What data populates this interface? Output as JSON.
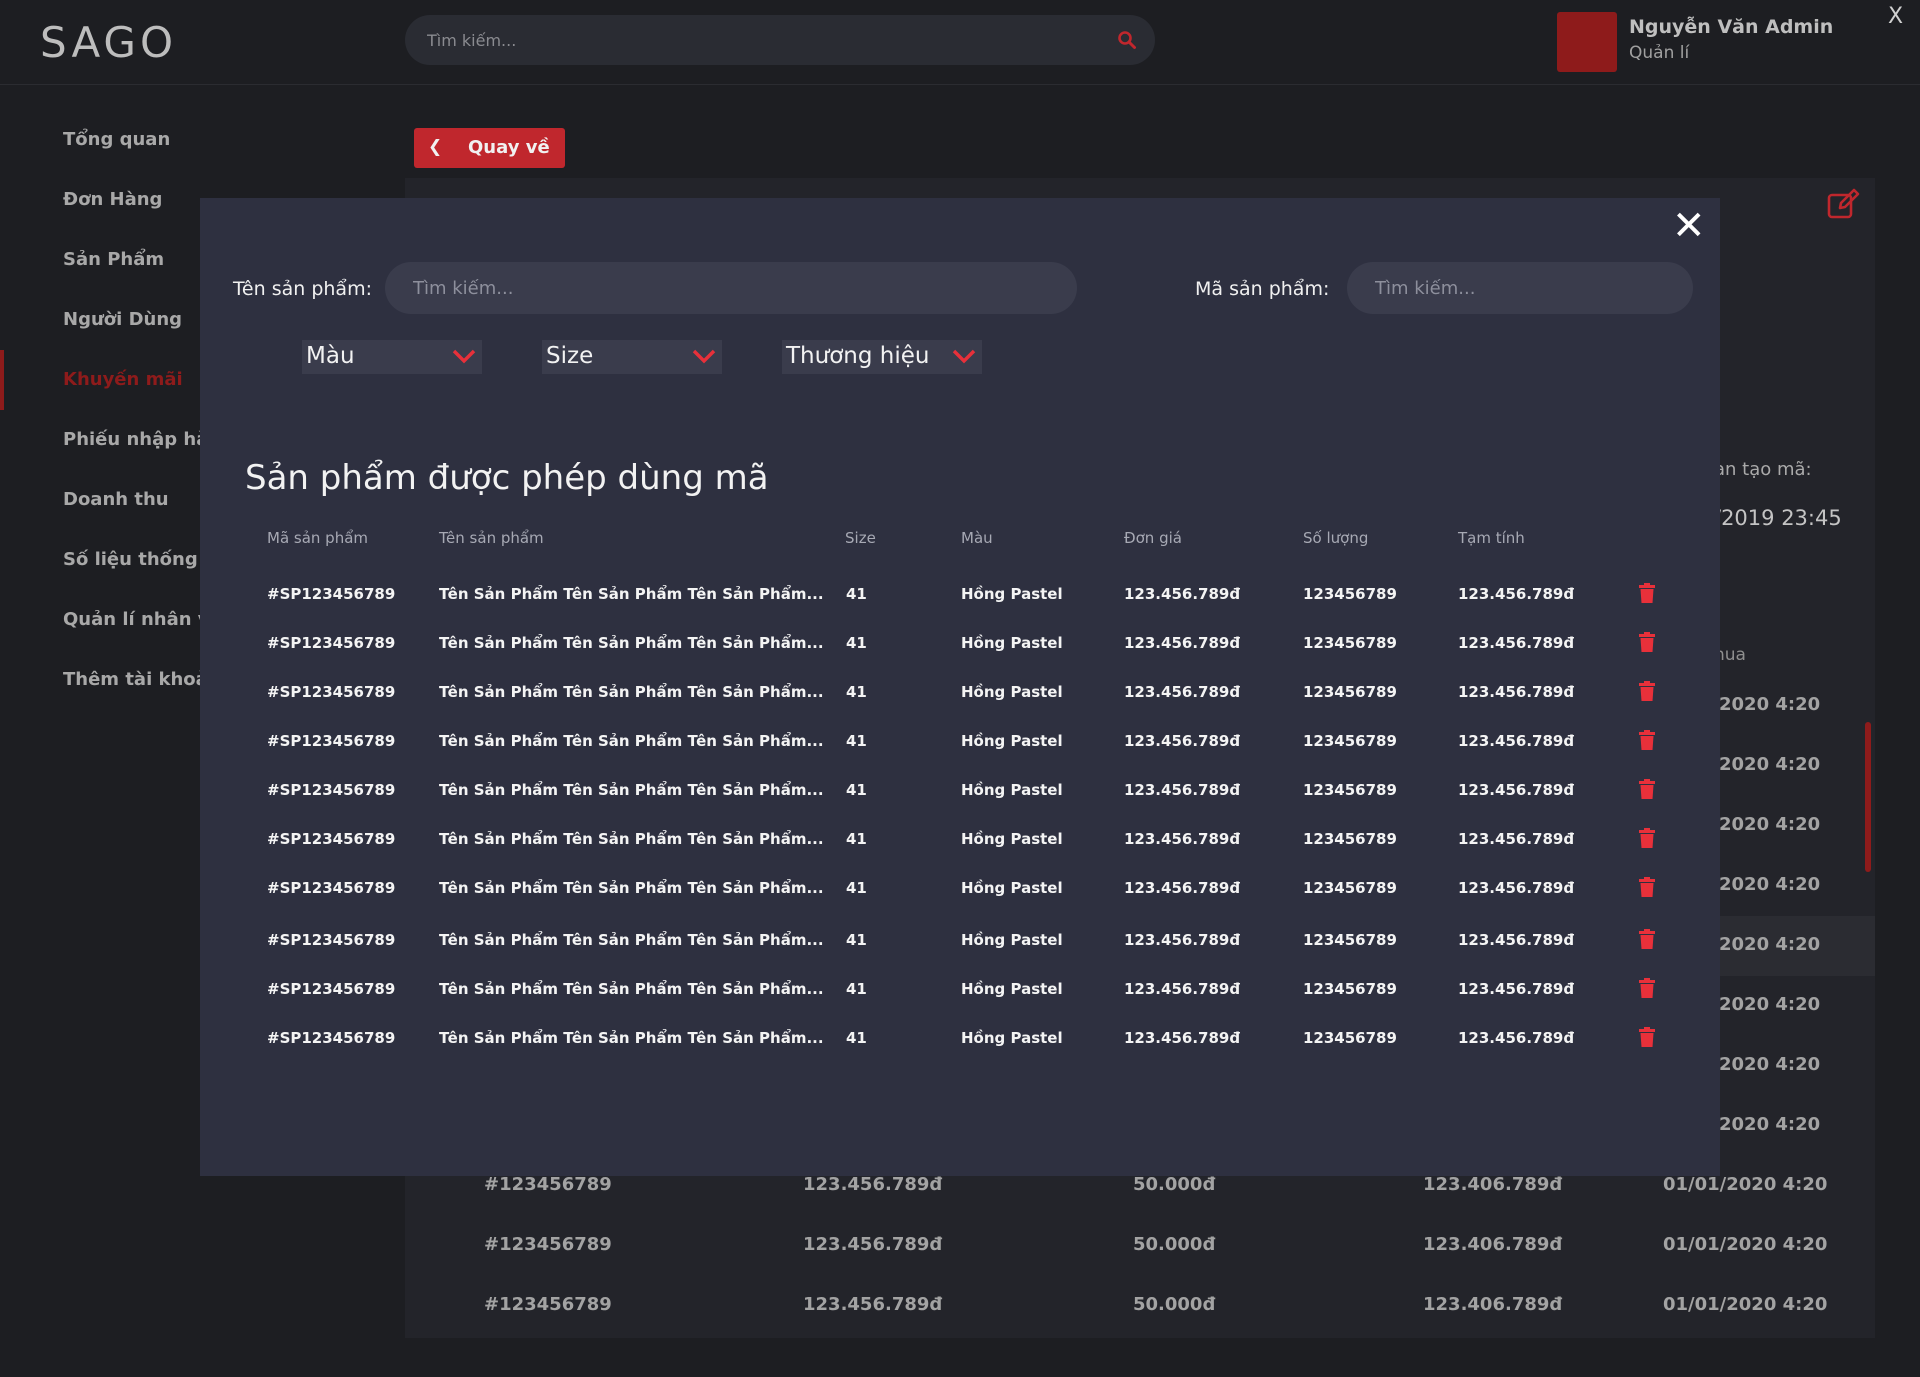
{
  "app": {
    "logo": "SAGO",
    "search_placeholder": "Tìm kiếm...",
    "user_name": "Nguyễn Văn Admin",
    "user_role": "Quản lí",
    "window_close": "X"
  },
  "sidebar": {
    "items": [
      {
        "label": "Tổng quan"
      },
      {
        "label": "Đơn Hàng"
      },
      {
        "label": "Sản Phẩm"
      },
      {
        "label": "Người Dùng"
      },
      {
        "label": "Khuyến mãi"
      },
      {
        "label": "Phiếu nhập hàng"
      },
      {
        "label": "Doanh thu"
      },
      {
        "label": "Số liệu thống kê"
      },
      {
        "label": "Quản lí nhân viên"
      },
      {
        "label": "Thêm tài khoản"
      }
    ]
  },
  "background": {
    "back_label": "Quay về",
    "partial_label_created": "an tạo mã:",
    "partial_date": "/2019 23:45",
    "partial_label_buy": "nua",
    "partial_times": [
      "2020 4:20",
      "2020 4:20",
      "2020 4:20",
      "2020 4:20",
      "2020 4:20",
      "2020 4:20",
      "2020 4:20",
      "2020 4:20"
    ],
    "rows": [
      {
        "id": "#123456789",
        "amount": "123.456.789đ",
        "discount": "50.000đ",
        "total": "123.406.789đ",
        "date": "01/01/2020 4:20"
      },
      {
        "id": "#123456789",
        "amount": "123.456.789đ",
        "discount": "50.000đ",
        "total": "123.406.789đ",
        "date": "01/01/2020 4:20"
      },
      {
        "id": "#123456789",
        "amount": "123.456.789đ",
        "discount": "50.000đ",
        "total": "123.406.789đ",
        "date": "01/01/2020 4:20"
      }
    ]
  },
  "modal": {
    "close": "✕",
    "product_name_label": "Tên sản phẩm:",
    "product_name_placeholder": "Tìm kiếm...",
    "product_code_label": "Mã sản phẩm:",
    "product_code_placeholder": "Tìm kiếm...",
    "filters": {
      "color": "Màu",
      "size": "Size",
      "brand": "Thương hiệu"
    },
    "title": "Sản phẩm được phép dùng mã",
    "columns": {
      "code": "Mã sản phẩm",
      "name": "Tên sản phẩm",
      "size": "Size",
      "color": "Màu",
      "price": "Đơn giá",
      "qty": "Số lượng",
      "subtotal": "Tạm tính"
    },
    "rows": [
      {
        "code": "#SP123456789",
        "name": "Tên Sản Phẩm Tên Sản Phẩm Tên Sản Phẩm...",
        "size": "41",
        "color": "Hồng Pastel",
        "price": "123.456.789đ",
        "qty": "123456789",
        "subtotal": "123.456.789đ"
      },
      {
        "code": "#SP123456789",
        "name": "Tên Sản Phẩm Tên Sản Phẩm Tên Sản Phẩm...",
        "size": "41",
        "color": "Hồng Pastel",
        "price": "123.456.789đ",
        "qty": "123456789",
        "subtotal": "123.456.789đ"
      },
      {
        "code": "#SP123456789",
        "name": "Tên Sản Phẩm Tên Sản Phẩm Tên Sản Phẩm...",
        "size": "41",
        "color": "Hồng Pastel",
        "price": "123.456.789đ",
        "qty": "123456789",
        "subtotal": "123.456.789đ"
      },
      {
        "code": "#SP123456789",
        "name": "Tên Sản Phẩm Tên Sản Phẩm Tên Sản Phẩm...",
        "size": "41",
        "color": "Hồng Pastel",
        "price": "123.456.789đ",
        "qty": "123456789",
        "subtotal": "123.456.789đ"
      },
      {
        "code": "#SP123456789",
        "name": "Tên Sản Phẩm Tên Sản Phẩm Tên Sản Phẩm...",
        "size": "41",
        "color": "Hồng Pastel",
        "price": "123.456.789đ",
        "qty": "123456789",
        "subtotal": "123.456.789đ"
      },
      {
        "code": "#SP123456789",
        "name": "Tên Sản Phẩm Tên Sản Phẩm Tên Sản Phẩm...",
        "size": "41",
        "color": "Hồng Pastel",
        "price": "123.456.789đ",
        "qty": "123456789",
        "subtotal": "123.456.789đ"
      },
      {
        "code": "#SP123456789",
        "name": "Tên Sản Phẩm Tên Sản Phẩm Tên Sản Phẩm...",
        "size": "41",
        "color": "Hồng Pastel",
        "price": "123.456.789đ",
        "qty": "123456789",
        "subtotal": "123.456.789đ"
      },
      {
        "code": "#SP123456789",
        "name": "Tên Sản Phẩm Tên Sản Phẩm Tên Sản Phẩm...",
        "size": "41",
        "color": "Hồng Pastel",
        "price": "123.456.789đ",
        "qty": "123456789",
        "subtotal": "123.456.789đ"
      },
      {
        "code": "#SP123456789",
        "name": "Tên Sản Phẩm Tên Sản Phẩm Tên Sản Phẩm...",
        "size": "41",
        "color": "Hồng Pastel",
        "price": "123.456.789đ",
        "qty": "123456789",
        "subtotal": "123.456.789đ"
      },
      {
        "code": "#SP123456789",
        "name": "Tên Sản Phẩm Tên Sản Phẩm Tên Sản Phẩm...",
        "size": "41",
        "color": "Hồng Pastel",
        "price": "123.456.789đ",
        "qty": "123456789",
        "subtotal": "123.456.789đ"
      }
    ]
  },
  "colors": {
    "accent": "#c0272d",
    "accent_dark": "#8e1b1b",
    "trash": "#e8303a",
    "background": "#1d1e22",
    "modal": "#2e3040"
  },
  "icons": {
    "search": "search-icon",
    "edit": "edit-icon",
    "trash": "trash-icon",
    "chevron": "chevron-down-icon",
    "back": "chevron-left-icon",
    "close": "close-icon"
  }
}
